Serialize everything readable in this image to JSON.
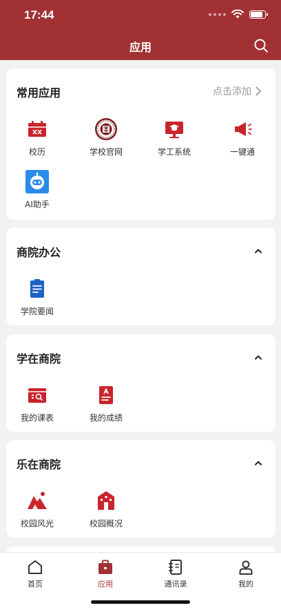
{
  "status_bar": {
    "time": "17:44"
  },
  "header": {
    "title": "应用",
    "search_icon": "search-icon"
  },
  "sections": {
    "common": {
      "title": "常用应用",
      "action": "点击添加",
      "apps": [
        {
          "label": "校历",
          "icon": "calendar-icon"
        },
        {
          "label": "学校官网",
          "icon": "school-emblem-icon"
        },
        {
          "label": "学工系统",
          "icon": "student-affairs-monitor-icon"
        },
        {
          "label": "一键通",
          "icon": "megaphone-icon"
        },
        {
          "label": "AI助手",
          "icon": "ai-robot-icon"
        }
      ]
    },
    "office": {
      "title": "商院办公",
      "apps": [
        {
          "label": "学院要闻",
          "icon": "news-document-icon"
        }
      ]
    },
    "study": {
      "title": "学在商院",
      "apps": [
        {
          "label": "我的课表",
          "icon": "timetable-icon"
        },
        {
          "label": "我的成绩",
          "icon": "grade-report-icon"
        }
      ]
    },
    "life": {
      "title": "乐在商院",
      "apps": [
        {
          "label": "校园风光",
          "icon": "scenery-mountain-icon"
        },
        {
          "label": "校园概况",
          "icon": "campus-building-icon"
        }
      ]
    }
  },
  "tabbar": {
    "items": [
      {
        "label": "首页",
        "icon": "home-icon"
      },
      {
        "label": "应用",
        "icon": "apps-briefcase-icon"
      },
      {
        "label": "通讯录",
        "icon": "contacts-book-icon"
      },
      {
        "label": "我的",
        "icon": "profile-icon"
      }
    ],
    "active": "应用"
  },
  "colors": {
    "brand": "#a23134",
    "icon_red": "#c8242c",
    "icon_blue": "#1c63c4",
    "ai_blue": "#2b8be8",
    "background": "#f2f2f2"
  }
}
